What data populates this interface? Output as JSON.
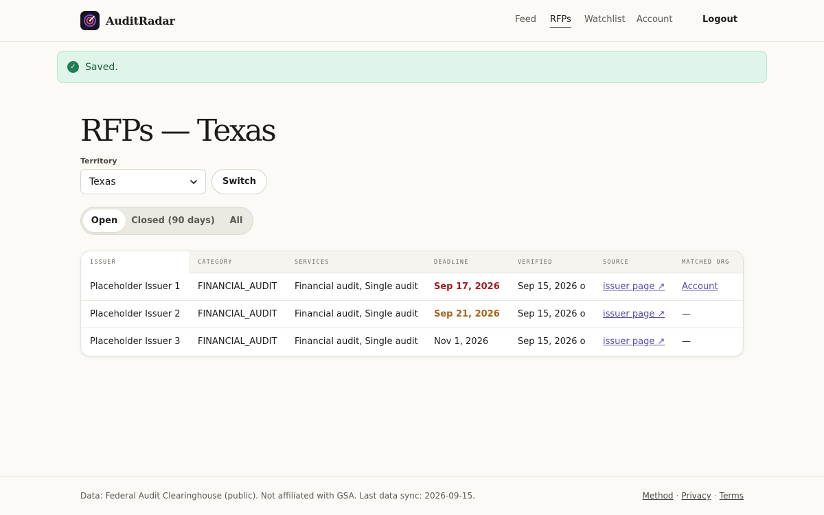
{
  "header": {
    "brand": "AuditRadar",
    "nav": [
      {
        "label": "Feed",
        "active": false
      },
      {
        "label": "RFPs",
        "active": true
      },
      {
        "label": "Watchlist",
        "active": false
      },
      {
        "label": "Account",
        "active": false
      }
    ],
    "logout_label": "Logout"
  },
  "flash": {
    "icon": "check-icon",
    "message": "Saved."
  },
  "page": {
    "title": "RFPs — Texas"
  },
  "territory": {
    "label": "Territory",
    "selected": "Texas",
    "switch_label": "Switch"
  },
  "tabs": [
    {
      "label": "Open",
      "active": true
    },
    {
      "label": "Closed (90 days)",
      "active": false
    },
    {
      "label": "All",
      "active": false
    }
  ],
  "table": {
    "columns": [
      "ISSUER",
      "CATEGORY",
      "SERVICES",
      "DEADLINE",
      "VERIFIED",
      "SOURCE",
      "MATCHED ORG"
    ],
    "rows": [
      {
        "issuer": "Placeholder Issuer 1",
        "category": "FINANCIAL_AUDIT",
        "services": "Financial audit, Single audit",
        "deadline": "Sep 17, 2026",
        "deadline_status": "urgent",
        "verified": "Sep 15, 2026 o",
        "source": "issuer page ↗",
        "matched_org": "Account",
        "matched_is_link": true
      },
      {
        "issuer": "Placeholder Issuer 2",
        "category": "FINANCIAL_AUDIT",
        "services": "Financial audit, Single audit",
        "deadline": "Sep 21, 2026",
        "deadline_status": "warning",
        "verified": "Sep 15, 2026 o",
        "source": "issuer page ↗",
        "matched_org": "—",
        "matched_is_link": false
      },
      {
        "issuer": "Placeholder Issuer 3",
        "category": "FINANCIAL_AUDIT",
        "services": "Financial audit, Single audit",
        "deadline": "Nov 1, 2026",
        "deadline_status": "normal",
        "verified": "Sep 15, 2026 o",
        "source": "issuer page ↗",
        "matched_org": "—",
        "matched_is_link": false
      }
    ]
  },
  "footer": {
    "note": "Data: Federal Audit Clearinghouse (public). Not affiliated with GSA. Last data sync: 2026-09-15.",
    "links": [
      "Method",
      "Privacy",
      "Terms"
    ],
    "separator": "·"
  },
  "colors": {
    "background": "#fbfaf7",
    "accent": "#5b49a8",
    "success": "#1e7d53",
    "urgent": "#a31d1d",
    "warning": "#a8621a"
  }
}
